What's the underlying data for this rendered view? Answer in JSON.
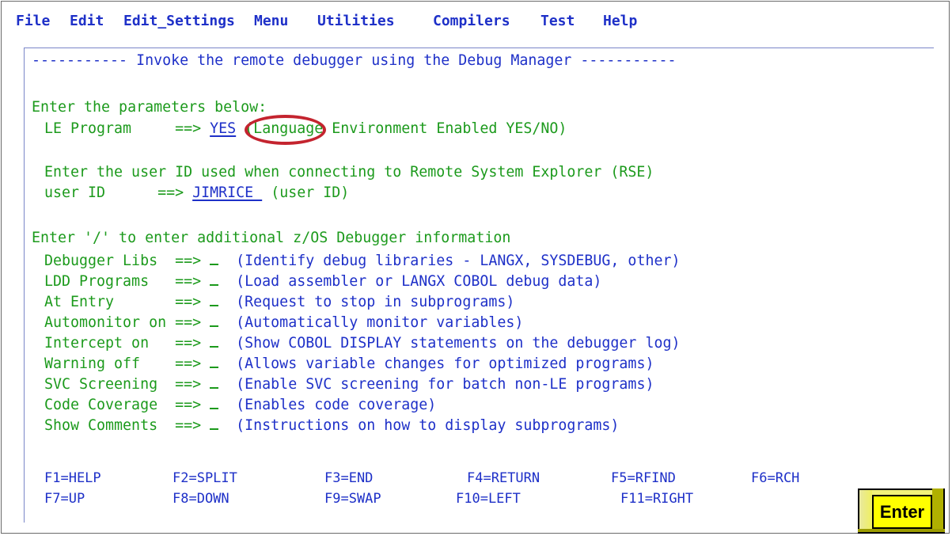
{
  "menubar": {
    "items": [
      "File",
      "Edit",
      "Edit_Settings",
      "Menu",
      "Utilities",
      "Compilers",
      "Test",
      "Help"
    ]
  },
  "panel": {
    "title": "----------- Invoke the remote debugger using the Debug Manager -----------",
    "enter_params": "Enter the parameters below:",
    "le_program": {
      "label": "LE Program     ==>",
      "value": "YES",
      "desc": " (Language Environment Enabled YES/NO)"
    },
    "userid_prompt": "Enter the user ID used when connecting to Remote System Explorer (RSE)",
    "user_id": {
      "label": "user ID      ==>",
      "value": "JIMRICE ",
      "desc": "(user ID)"
    },
    "additional_prompt": "Enter '/' to enter additional z/OS Debugger information",
    "options": [
      {
        "label": "Debugger Libs  ==>",
        "desc": "(Identify debug libraries - LANGX, SYSDEBUG, other)"
      },
      {
        "label": "LDD Programs   ==>",
        "desc": "(Load assembler or LANGX COBOL debug data)"
      },
      {
        "label": "At Entry       ==>",
        "desc": "(Request to stop in subprograms)"
      },
      {
        "label": "Automonitor on ==>",
        "desc": "(Automatically monitor variables)"
      },
      {
        "label": "Intercept on   ==>",
        "desc": "(Show COBOL DISPLAY statements on the debugger log)"
      },
      {
        "label": "Warning off    ==>",
        "desc": "(Allows variable changes for optimized programs)"
      },
      {
        "label": "SVC Screening  ==>",
        "desc": "(Enable SVC screening for batch non-LE programs)"
      },
      {
        "label": "Code Coverage  ==>",
        "desc": "(Enables code coverage)"
      },
      {
        "label": "Show Comments  ==>",
        "desc": "(Instructions on how to display subprograms)"
      }
    ]
  },
  "fkeys": {
    "row1": [
      "F1=HELP",
      "F2=SPLIT",
      "F3=END",
      "F4=RETURN",
      "F5=RFIND",
      "F6=RCH"
    ],
    "row2": [
      "F7=UP",
      "F8=DOWN",
      "F9=SWAP",
      "F10=LEFT",
      "F11=RIGHT"
    ]
  },
  "enter_button": {
    "label": "Enter"
  },
  "colors": {
    "green": "#1c9a1c",
    "blue": "#1e30c8",
    "highlight": "#c4242f",
    "button": "#ffff00"
  }
}
